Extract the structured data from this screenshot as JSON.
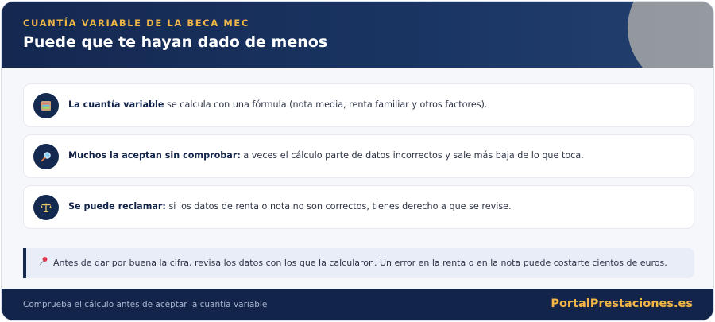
{
  "header": {
    "eyebrow": "CUANTÍA VARIABLE DE LA BECA MEC",
    "title": "Puede que te hayan dado de menos"
  },
  "items": [
    {
      "icon": "abacus-icon",
      "bold": "La cuantía variable",
      "text": " se calcula con una fórmula (nota media, renta familiar y otros factores)."
    },
    {
      "icon": "magnifier-icon",
      "bold": "Muchos la aceptan sin comprobar:",
      "text": " a veces el cálculo parte de datos incorrectos y sale más baja de lo que toca."
    },
    {
      "icon": "scales-icon",
      "bold": "Se puede reclamar:",
      "text": " si los datos de renta o nota no son correctos, tienes derecho a que se revise."
    }
  ],
  "note": {
    "icon": "pushpin-icon",
    "text": "Antes de dar por buena la cifra, revisa los datos con los que la calcularon. Un error en la renta o en la nota puede costarte cientos de euros."
  },
  "footer": {
    "text": "Comprueba el cálculo antes de aceptar la cuantía variable",
    "brand": "PortalPrestaciones.es"
  },
  "colors": {
    "navy": "#13294f",
    "accent": "#f0b545",
    "note_bg": "#e8edf8"
  }
}
